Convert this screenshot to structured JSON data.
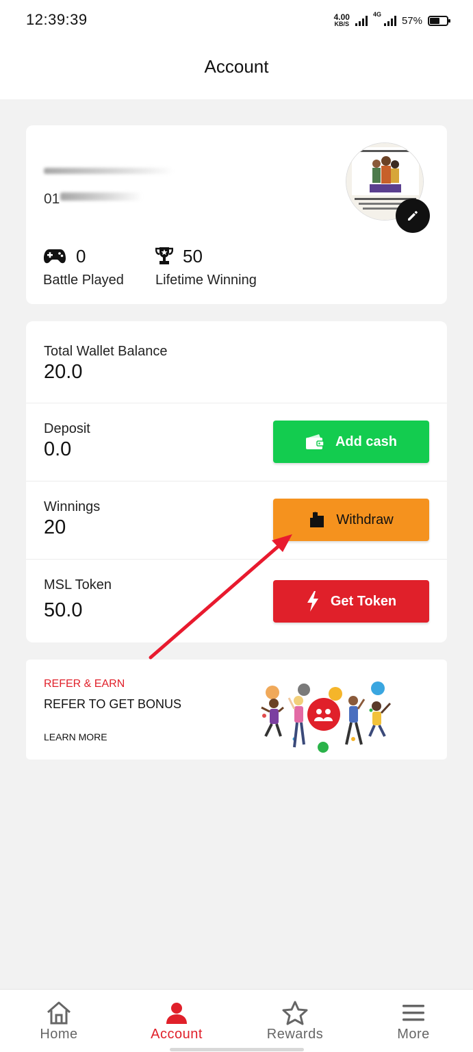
{
  "status_bar": {
    "time": "12:39:39",
    "speed_value": "4.00",
    "speed_unit": "KB/S",
    "network": "4G",
    "battery": "57%",
    "battery_level": 0.57
  },
  "header": {
    "title": "Account"
  },
  "profile": {
    "phone_prefix": "01",
    "stats": [
      {
        "icon": "gamepad-icon",
        "value": "0",
        "label": "Battle Played"
      },
      {
        "icon": "trophy-icon",
        "value": "50",
        "label": "Lifetime Winning"
      }
    ]
  },
  "wallet": {
    "total_label": "Total Wallet Balance",
    "total_value": "20.0",
    "deposit_label": "Deposit",
    "deposit_value": "0.0",
    "add_cash_label": "Add cash",
    "winnings_label": "Winnings",
    "winnings_value": "20",
    "withdraw_label": "Withdraw",
    "token_label": "MSL Token",
    "token_value": "50.0",
    "get_token_label": "Get Token"
  },
  "refer": {
    "title": "REFER & EARN",
    "subtitle": "REFER TO GET BONUS",
    "link": "LEARN MORE"
  },
  "nav": {
    "items": [
      {
        "label": "Home",
        "icon": "home-icon"
      },
      {
        "label": "Account",
        "icon": "user-icon"
      },
      {
        "label": "Rewards",
        "icon": "star-icon"
      },
      {
        "label": "More",
        "icon": "menu-icon"
      }
    ],
    "active": "Account"
  },
  "colors": {
    "brand_red": "#e0202a",
    "add_cash_green": "#13cc4f",
    "withdraw_orange": "#f5921e",
    "background": "#f2f2f2"
  }
}
